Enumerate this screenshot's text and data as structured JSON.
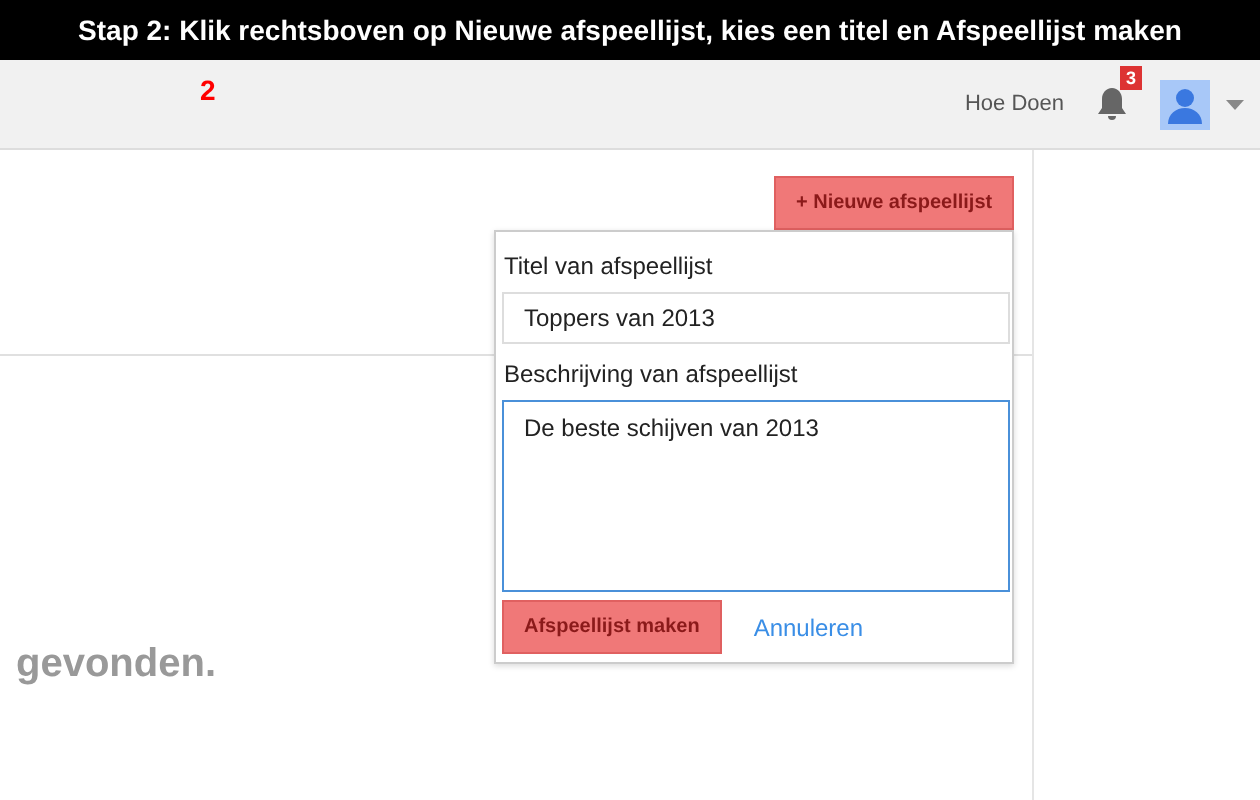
{
  "banner": {
    "title": "Stap 2: Klik rechtsboven op Nieuwe afspeellijst, kies een titel en Afspeellijst maken"
  },
  "header": {
    "step_marker": "2",
    "help_link": "Hoe Doen",
    "notification_count": "3"
  },
  "new_playlist_button": {
    "label": "+ Nieuwe afspeellijst"
  },
  "content": {
    "message": "gevonden."
  },
  "popup": {
    "title_label": "Titel van afspeellijst",
    "title_value": "Toppers van 2013",
    "description_label": "Beschrijving van afspeellijst",
    "description_value": "De beste schijven van 2013",
    "create_button": "Afspeellijst maken",
    "cancel_link": "Annuleren"
  }
}
